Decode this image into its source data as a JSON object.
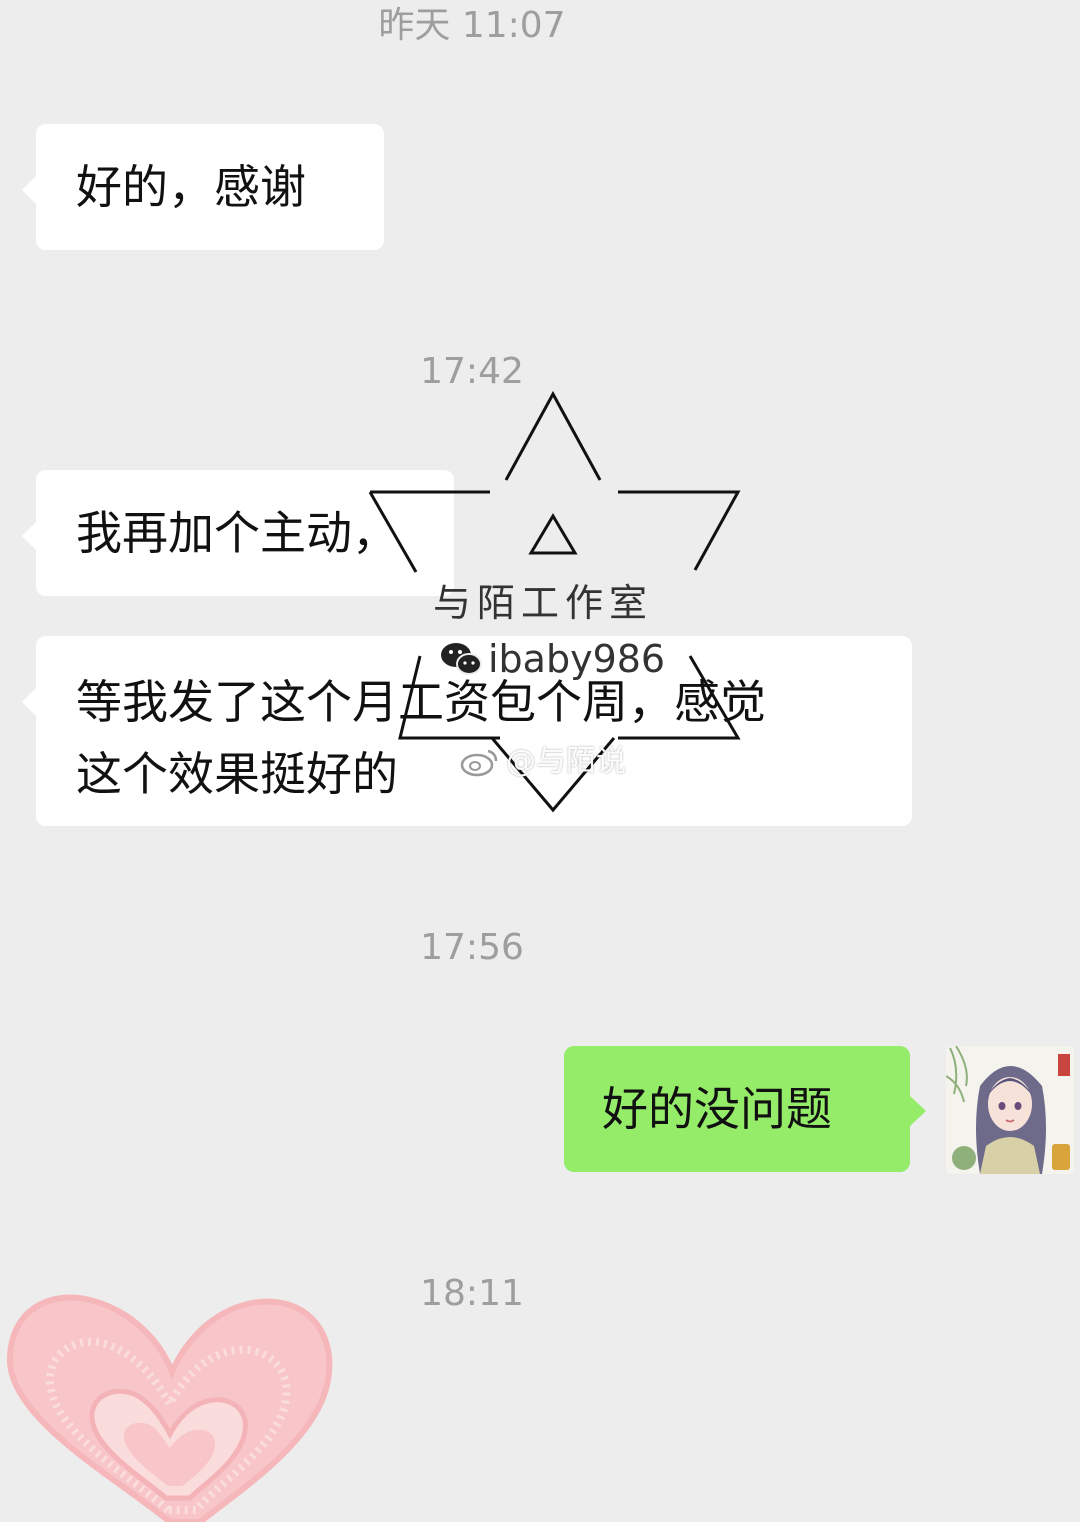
{
  "chat": {
    "timestamps": [
      "昨天 11:07",
      "17:42",
      "17:56",
      "18:11"
    ],
    "messages": [
      {
        "side": "in",
        "text": "好的，感谢"
      },
      {
        "side": "in",
        "text": "我再加个主动，"
      },
      {
        "side": "in",
        "line1": "等我发了这个月工资包个周，感觉",
        "line2": "这个效果挺好的"
      },
      {
        "side": "out",
        "text": "好的没问题"
      }
    ]
  },
  "watermark": {
    "studio": "与陌工作室",
    "wechat_id": "ibaby986",
    "weibo": "@与陌说",
    "icons": [
      "wechat-icon",
      "weibo-icon"
    ]
  },
  "colors": {
    "background": "#ededed",
    "incoming_bubble": "#ffffff",
    "outgoing_bubble": "#95ec69",
    "timestamp": "#9e9e9e",
    "heart": "#f6b7bb"
  }
}
